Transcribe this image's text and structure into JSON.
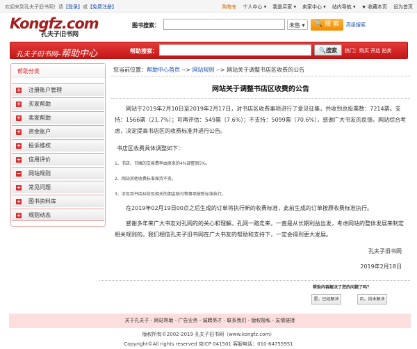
{
  "topbar": {
    "welcome": "欢迎来到孔夫子旧书网！请",
    "login": "【登录】",
    "or": "或",
    "register": "【免费注册】",
    "links": [
      "购物车",
      "个人中心 ▾",
      "我是买家 ▾",
      "卖家中心 ▾",
      "站内导航 ▾",
      "★ 收藏本页",
      "设为首页"
    ]
  },
  "logo": {
    "text": "Kongfz.com",
    "sub": "孔夫子旧书网"
  },
  "search": {
    "label": "图书搜索：",
    "value": "",
    "select": "未售",
    "button": "搜 索",
    "advanced": "高级搜索"
  },
  "banner": {
    "site": "孔夫子旧书网–",
    "center": "帮助中心",
    "label": "帮助搜索：",
    "value": "",
    "button": "搜索",
    "hot": "热门：购买 开店 拍卖"
  },
  "sidebar": {
    "title": "帮助分类",
    "items": [
      {
        "label": "注册账户管理",
        "icon": "+"
      },
      {
        "label": "买家帮助",
        "icon": "+"
      },
      {
        "label": "卖家帮助",
        "icon": "+"
      },
      {
        "label": "资金账户",
        "icon": "+"
      },
      {
        "label": "投诉维权",
        "icon": "+"
      },
      {
        "label": "信用评价",
        "icon": "+"
      },
      {
        "label": "网站规则",
        "icon": "−"
      },
      {
        "label": "常见问题",
        "icon": "+"
      },
      {
        "label": "图书资料库",
        "icon": "+"
      },
      {
        "label": "规则动态",
        "icon": "+"
      }
    ]
  },
  "breadcrumb": {
    "prefix": "您当前位置：",
    "home": "帮助中心首页",
    "sep": " --> ",
    "rules": "网站规则",
    "current": "网站关于调整书店区收费的公告"
  },
  "article": {
    "title": "网站关于调整书店区收费的公告",
    "p1": "网站于2019年2月10日至2019年2月17日，对书店区收费事项进行了意见征集，共收到总投票数：7214票。支持：1566票（21.7%）；可再评估：549票（7.6%）；不支持：5099票（70.6%），感谢广大书友的反馈。网站综合考虑，决定提高书店区的收费标准并进行公告。",
    "p2": "书店区收费具体调整如下：",
    "items": [
      "1、书店、书摊的交易费率由原来的4%调整到5%。",
      "2、网站其他收费标准保持不变。",
      "3、涉及到书店纠纷及相关的佣金赔付等事项按新标准执行。"
    ],
    "p3": "在2019年02月19日00点之后生成的订单将执行新的收费标准，此前生成的订单按原收费标准执行。",
    "p4": "感谢多年来广大书友对孔网的的关心和理解。孔网一路走来，一直是从长期利益出发，考虑网站的整体发展来制定相关规则的。我们相信孔夫子旧书网在广大书友的帮助和支持下，一定会得到更大发展。",
    "signature": "孔夫子旧书网",
    "date": "2019年2月18日"
  },
  "feedback": {
    "question": "帮助内容解决了您的问题了吗？",
    "yes": "是，已经解决",
    "no": "否，尚未解决"
  },
  "footer": {
    "links": "关于孔夫子 - 网站帮助 - 广告业务 - 诚聘英才 - 联系我们 - 版权隐私 - 友情链接",
    "copyright": "版权所有©2002-2019 孔夫子旧书网（www.kongfz.com）",
    "icp": "Copyright©All rights reserved 京ICP 041501   客服电话：010-64755951"
  }
}
